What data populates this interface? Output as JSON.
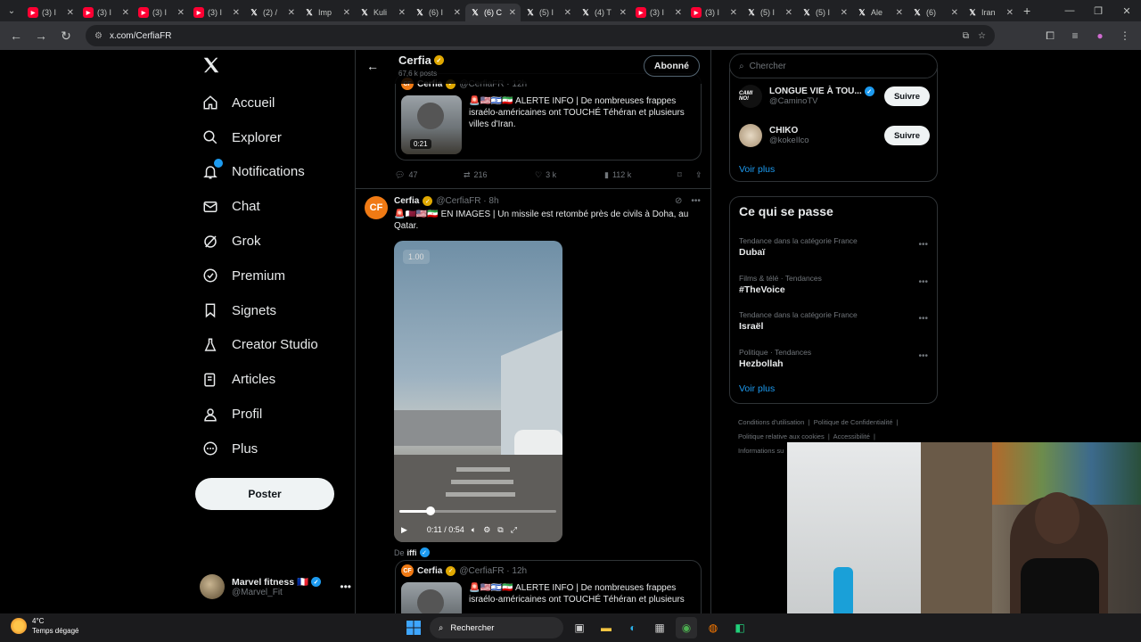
{
  "browser": {
    "tabs": [
      {
        "kind": "yt",
        "label": "(3) I"
      },
      {
        "kind": "yt",
        "label": "(3) I"
      },
      {
        "kind": "yt",
        "label": "(3) I"
      },
      {
        "kind": "yt",
        "label": "(3) I"
      },
      {
        "kind": "x",
        "label": "(2) /"
      },
      {
        "kind": "x",
        "label": "Imp"
      },
      {
        "kind": "x",
        "label": "Kuli"
      },
      {
        "kind": "x",
        "label": "(6) I"
      },
      {
        "kind": "x",
        "label": "(6) C",
        "active": true
      },
      {
        "kind": "x",
        "label": "(5) I"
      },
      {
        "kind": "x",
        "label": "(4) T"
      },
      {
        "kind": "yt",
        "label": "(3) I"
      },
      {
        "kind": "yt",
        "label": "(3) I"
      },
      {
        "kind": "x",
        "label": "(5) I"
      },
      {
        "kind": "x",
        "label": "(5) I"
      },
      {
        "kind": "x",
        "label": "Ale"
      },
      {
        "kind": "x",
        "label": "(6)"
      },
      {
        "kind": "x",
        "label": "Iran"
      }
    ],
    "url": "x.com/CerfiaFR"
  },
  "nav": {
    "items": [
      {
        "label": "Accueil",
        "icon": "home-icon"
      },
      {
        "label": "Explorer",
        "icon": "search-icon"
      },
      {
        "label": "Notifications",
        "icon": "bell-icon"
      },
      {
        "label": "Chat",
        "icon": "mail-icon"
      },
      {
        "label": "Grok",
        "icon": "grok-icon"
      },
      {
        "label": "Premium",
        "icon": "premium-icon"
      },
      {
        "label": "Signets",
        "icon": "bookmark-icon"
      },
      {
        "label": "Creator Studio",
        "icon": "creator-icon"
      },
      {
        "label": "Articles",
        "icon": "articles-icon"
      },
      {
        "label": "Profil",
        "icon": "person-icon"
      },
      {
        "label": "Plus",
        "icon": "more-circle-icon"
      }
    ],
    "post_label": "Poster",
    "account": {
      "name": "Marvel fitness 🇫🇷",
      "handle": "@Marvel_Fit"
    }
  },
  "profile_header": {
    "title": "Cerfia",
    "posts": "67,6 k posts",
    "follow_label": "Abonné"
  },
  "quoted_tweet_1": {
    "author": "Cerfia",
    "handle": "@CerfiaFR · 12h",
    "duration": "0:21",
    "text": "🚨🇺🇸🇮🇱🇮🇷 ALERTE INFO | De nombreuses frappes israélo-américaines ont TOUCHÉ Téhéran et plusieurs villes d'Iran."
  },
  "actions_1": {
    "replies": "47",
    "reposts": "216",
    "likes": "3 k",
    "views": "112 k"
  },
  "tweet": {
    "author": "Cerfia",
    "handle": "@CerfiaFR · 8h",
    "text": "🚨🇶🇦🇺🇸🇮🇷 EN IMAGES | Un missile est retombé près de civils à Doha, au Qatar.",
    "video": {
      "speed": "1.00",
      "time": "0:11 / 0:54",
      "progress": 0.2
    },
    "from_label": "De",
    "from_user": "iffi"
  },
  "quoted_tweet_2": {
    "author": "Cerfia",
    "handle": "@CerfiaFR · 12h",
    "text": "🚨🇺🇸🇮🇱🇮🇷 ALERTE INFO | De nombreuses frappes israélo-américaines ont TOUCHÉ Téhéran et plusieurs"
  },
  "sidebar": {
    "search_placeholder": "Chercher",
    "follow": [
      {
        "name": "LONGUE VIE À TOU...",
        "handle": "@CaminoTV",
        "button": "Suivre",
        "avatar_text": "CAMI NO!"
      },
      {
        "name": "CHIKO",
        "handle": "@kokeIlco",
        "button": "Suivre"
      }
    ],
    "see_more": "Voir plus",
    "trends_title": "Ce qui se passe",
    "trends": [
      {
        "category": "Tendance dans la catégorie France",
        "name": "Dubaï"
      },
      {
        "category": "Films & télé · Tendances",
        "name": "#TheVoice"
      },
      {
        "category": "Tendance dans la catégorie France",
        "name": "Israël"
      },
      {
        "category": "Politique · Tendances",
        "name": "Hezbollah"
      }
    ],
    "trends_more": "Voir plus",
    "footer": [
      "Conditions d'utilisation",
      "Politique de Confidentialité",
      "Politique relative aux cookies",
      "Accessibilité",
      "Informations su"
    ]
  },
  "taskbar": {
    "temp": "4°C",
    "weather": "Temps dégagé",
    "search": "Rechercher"
  }
}
